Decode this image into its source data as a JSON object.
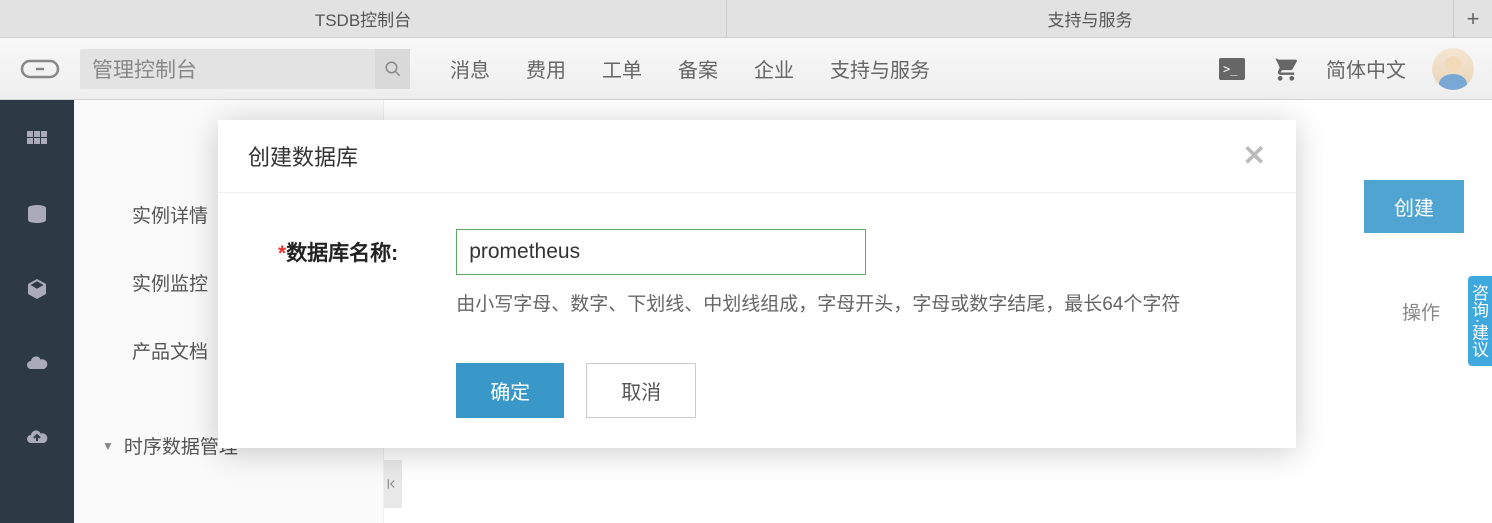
{
  "tabs": {
    "items": [
      "TSDB控制台",
      "支持与服务"
    ],
    "add": "+"
  },
  "header": {
    "search_value": "管理控制台",
    "nav": [
      "消息",
      "费用",
      "工单",
      "备案",
      "企业",
      "支持与服务"
    ],
    "lang": "简体中文"
  },
  "sub_sidebar": {
    "items": [
      "实例详情",
      "实例监控",
      "产品文档"
    ],
    "expand": "时序数据管理"
  },
  "content": {
    "create_btn": "创建",
    "ops": "操作",
    "side_panel": "咨询·建议"
  },
  "modal": {
    "title": "创建数据库",
    "label": "数据库名称:",
    "required_mark": "*",
    "value": "prometheus",
    "hint": "由小写字母、数字、下划线、中划线组成，字母开头，字母或数字结尾，最长64个字符",
    "confirm": "确定",
    "cancel": "取消"
  }
}
